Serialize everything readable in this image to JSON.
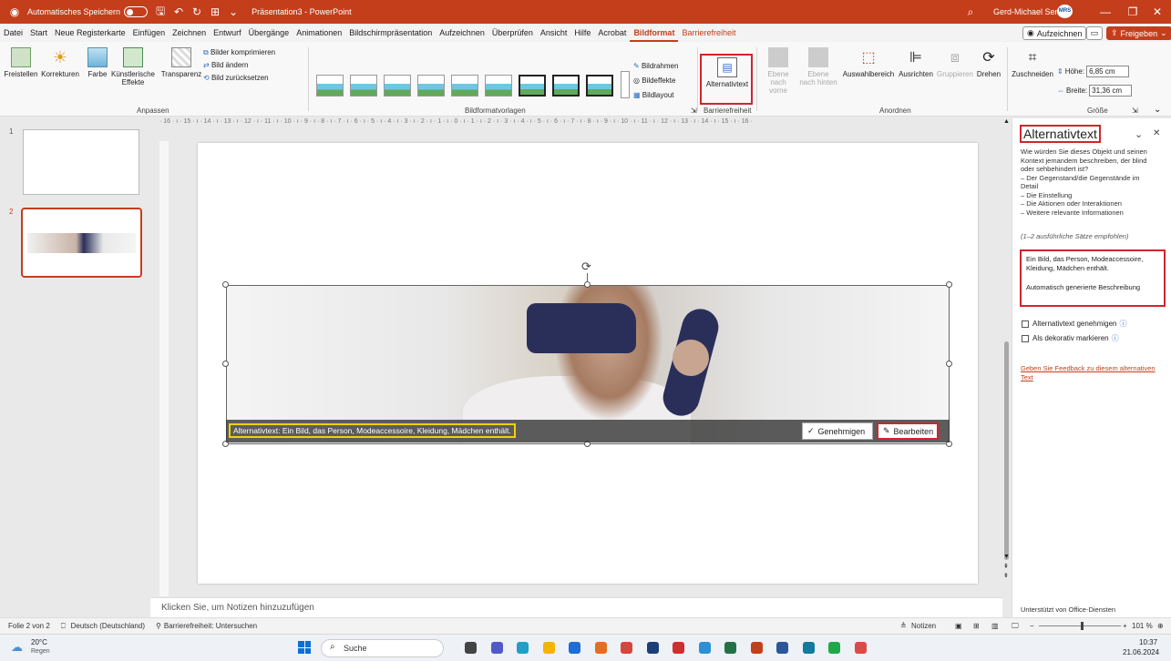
{
  "title_bar": {
    "autosave_label": "Automatisches Speichern",
    "doc_title": "Präsentation3 - PowerPoint",
    "user_name": "Gerd-Michael Sens",
    "avatar_initials": "MRS"
  },
  "menu": {
    "tabs": [
      "Datei",
      "Start",
      "Neue Registerkarte",
      "Einfügen",
      "Zeichnen",
      "Entwurf",
      "Übergänge",
      "Animationen",
      "Bildschirmpräsentation",
      "Aufzeichnen",
      "Überprüfen",
      "Ansicht",
      "Hilfe",
      "Acrobat",
      "Bildformat",
      "Barrierefreiheit"
    ],
    "active_tab": "Bildformat",
    "record_button": "Aufzeichnen",
    "share_button": "Freigeben"
  },
  "ribbon": {
    "freistellen": "Freistellen",
    "korrekturen": "Korrekturen",
    "farbe": "Farbe",
    "kuenstlerische": "Künstlerische Effekte",
    "transparenz": "Transparenz",
    "bilder_komprimieren": "Bilder komprimieren",
    "bild_aendern": "Bild ändern",
    "bild_zuruecksetzen": "Bild zurücksetzen",
    "group_anpassen": "Anpassen",
    "group_bildformatvorlagen": "Bildformatvorlagen",
    "bildrahmen": "Bildrahmen",
    "bildeffekte": "Bildeffekte",
    "bildlayout": "Bildlayout",
    "alternativtext": "Alternativtext",
    "group_barrierefreiheit": "Barrierefreiheit",
    "ebene_vorne": "Ebene nach vorne",
    "ebene_hinten": "Ebene nach hinten",
    "auswahlbereich": "Auswahlbereich",
    "ausrichten": "Ausrichten",
    "gruppieren": "Gruppieren",
    "drehen": "Drehen",
    "group_anordnen": "Anordnen",
    "zuschneiden": "Zuschneiden",
    "hoehe_label": "Höhe:",
    "hoehe_value": "6,85 cm",
    "breite_label": "Breite:",
    "breite_value": "31,36 cm",
    "group_groesse": "Größe"
  },
  "ruler_h": "· 16 · ı · 15 · ı · 14 · ı · 13 · ı · 12 · ı · 11 · ı · 10 · ı · 9 · ı · 8 · ı · 7 · ı · 6 · ı · 5 · ı · 4 · ı · 3 · ı · 2 · ı · 1 · ı · 0 · ı · 1 · ı · 2 · ı · 3 · ı · 4 · ı · 5 · ı · 6 · ı · 7 · ı · 8 · ı · 9 · ı · 10 · ı · 11 · ı · 12 · ı · 13 · ı · 14 · ı · 15 · ı · 16 ·",
  "slides": {
    "num1": "1",
    "num2": "2"
  },
  "picture": {
    "alt_text": "Alternativtext:  Ein Bild, das Person, Modeaccessoire, Kleidung, Mädchen enthält.",
    "approve": "Genehmigen",
    "edit": "Bearbeiten"
  },
  "notes_placeholder": "Klicken Sie, um Notizen hinzuzufügen",
  "pane": {
    "title": "Alternativtext",
    "description": "Wie würden Sie dieses Objekt und seinen Kontext jemandem beschreiben, der blind oder sehbehindert ist?\n– Der Gegenstand/die Gegenstände im Detail\n– Die Einstellung\n– Die Aktionen oder Interaktionen\n– Weitere relevante Informationen",
    "hint": "(1–2 ausführliche Sätze empfohlen)",
    "alt_value_line1": "Ein Bild, das Person, Modeaccessoire, Kleidung, Mädchen enthält.",
    "alt_value_line2": "Automatisch generierte Beschreibung",
    "check_approve": "Alternativtext genehmigen",
    "check_decorative": "Als dekorativ markieren",
    "feedback_link": "Geben Sie Feedback zu diesem alternativen Text",
    "footer": "Unterstützt von Office-Diensten"
  },
  "status": {
    "slide_info": "Folie 2 von 2",
    "language": "Deutsch (Deutschland)",
    "accessibility": "Barrierefreiheit: Untersuchen",
    "notes": "Notizen",
    "zoom": "101 %"
  },
  "taskbar": {
    "weather_temp": "20°C",
    "weather_desc": "Regen",
    "search": "Suche",
    "time": "10:37",
    "date": "21.06.2024"
  }
}
